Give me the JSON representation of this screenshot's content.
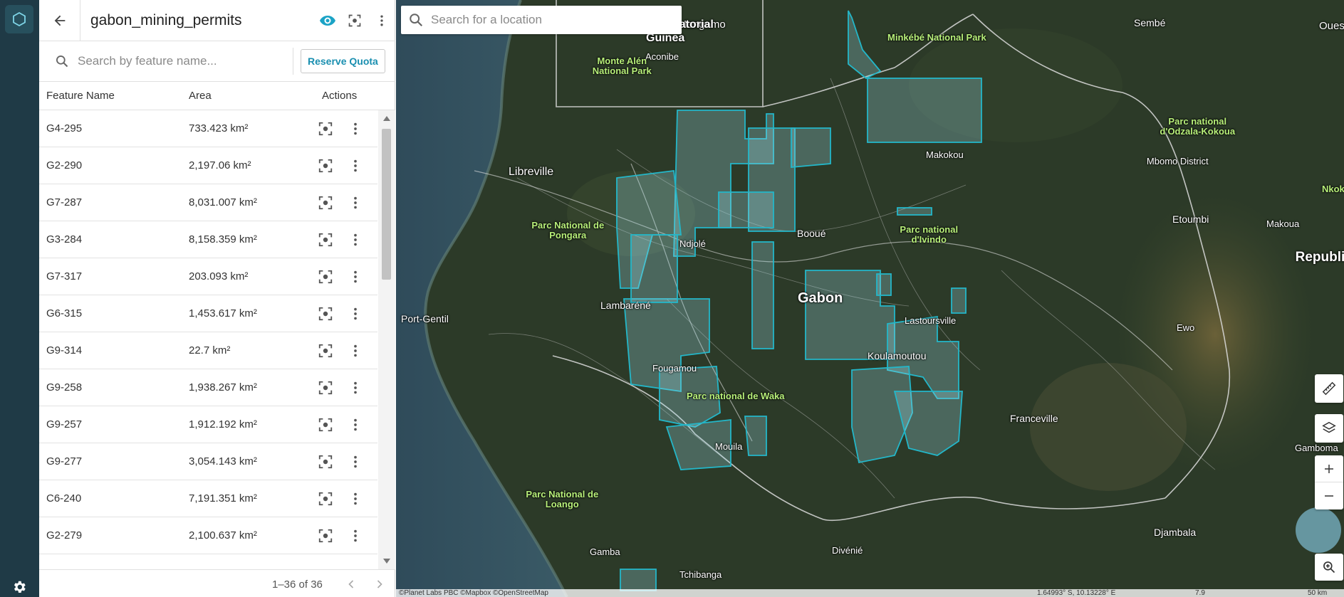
{
  "panel": {
    "title": "gabon_mining_permits",
    "search_placeholder": "Search by feature name...",
    "reserve_quota_label": "Reserve Quota",
    "columns": {
      "name": "Feature Name",
      "area": "Area",
      "actions": "Actions"
    },
    "rows": [
      {
        "name": "G4-295",
        "area": "733.423 km²"
      },
      {
        "name": "G2-290",
        "area": "2,197.06 km²"
      },
      {
        "name": "G7-287",
        "area": "8,031.007 km²"
      },
      {
        "name": "G3-284",
        "area": "8,158.359 km²"
      },
      {
        "name": "G7-317",
        "area": "203.093 km²"
      },
      {
        "name": "G6-315",
        "area": "1,453.617 km²"
      },
      {
        "name": "G9-314",
        "area": "22.7 km²"
      },
      {
        "name": "G9-258",
        "area": "1,938.267 km²"
      },
      {
        "name": "G9-257",
        "area": "1,912.192 km²"
      },
      {
        "name": "G9-277",
        "area": "3,054.143 km²"
      },
      {
        "name": "C6-240",
        "area": "7,191.351 km²"
      },
      {
        "name": "G2-279",
        "area": "2,100.637 km²"
      }
    ],
    "pagination": "1–36 of 36"
  },
  "map": {
    "search_placeholder": "Search for a location",
    "labels": [
      {
        "id": "mongomo",
        "text": "Mongomo"
      },
      {
        "id": "acoibe",
        "text": "Aconibe"
      },
      {
        "id": "guinea",
        "text": "Guinea"
      },
      {
        "id": "quatorial",
        "text": "uatorial"
      },
      {
        "id": "monte-alen",
        "text": "Monte Alén National Park"
      },
      {
        "id": "minkebe",
        "text": "Minkébé National Park"
      },
      {
        "id": "sembe",
        "text": "Sembé"
      },
      {
        "id": "ouesso",
        "text": "Ouess"
      },
      {
        "id": "odzala",
        "text": "Parc national d'Odzala-Kokoua"
      },
      {
        "id": "makokou",
        "text": "Makokou"
      },
      {
        "id": "mbomo",
        "text": "Mbomo District"
      },
      {
        "id": "libreville",
        "text": "Libreville"
      },
      {
        "id": "pongara",
        "text": "Parc National de Pongara"
      },
      {
        "id": "booue",
        "text": "Booué"
      },
      {
        "id": "ivindo",
        "text": "Parc national d'Ivindo"
      },
      {
        "id": "etoumbi",
        "text": "Etoumbi"
      },
      {
        "id": "makoua",
        "text": "Makoua"
      },
      {
        "id": "nkok",
        "text": "Nkok"
      },
      {
        "id": "ndjole",
        "text": "Ndjolé"
      },
      {
        "id": "republic",
        "text": "Republic the Con"
      },
      {
        "id": "port-gentil",
        "text": "Port-Gentil"
      },
      {
        "id": "lambarene",
        "text": "Lambaréné"
      },
      {
        "id": "gabon",
        "text": "Gabon"
      },
      {
        "id": "lastoursville",
        "text": "Lastoursville"
      },
      {
        "id": "ewo",
        "text": "Ewo"
      },
      {
        "id": "koulamoutou",
        "text": "Koulamoutou"
      },
      {
        "id": "fougamou",
        "text": "Fougamou"
      },
      {
        "id": "waka",
        "text": "Parc national de Waka"
      },
      {
        "id": "franceville",
        "text": "Franceville"
      },
      {
        "id": "mouila",
        "text": "Mouila"
      },
      {
        "id": "gamboma",
        "text": "Gamboma"
      },
      {
        "id": "loango",
        "text": "Parc National de Loango"
      },
      {
        "id": "djambala",
        "text": "Djambala"
      },
      {
        "id": "gamba",
        "text": "Gamba"
      },
      {
        "id": "divenie",
        "text": "Divénié"
      },
      {
        "id": "tchibanga",
        "text": "Tchibanga"
      }
    ],
    "attribution": "©Planet Labs PBC ©Mapbox ©OpenStreetMap",
    "coordinates": "1.64993° S, 10.13228° E",
    "zoom_level": "7.9",
    "scale": "50 km"
  }
}
